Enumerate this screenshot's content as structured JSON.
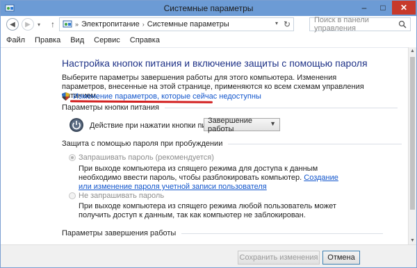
{
  "window": {
    "title": "Системные параметры"
  },
  "nav": {
    "breadcrumbs": [
      "Электропитание",
      "Системные параметры"
    ],
    "search_placeholder": "Поиск в панели управления"
  },
  "menu": [
    "Файл",
    "Правка",
    "Вид",
    "Сервис",
    "Справка"
  ],
  "main": {
    "title": "Настройка кнопок питания и включение защиты с помощью пароля",
    "intro": "Выберите параметры завершения работы для этого компьютера. Изменения параметров, внесенные на этой странице, применяются ко всем схемам управления питанием.",
    "change_link": "Изменение параметров, которые сейчас недоступны",
    "power_section": {
      "heading": "Параметры кнопки питания",
      "action_label": "Действие при нажатии кнопки питания:",
      "action_value": "Завершение работы"
    },
    "password_section": {
      "heading": "Защита с помощью пароля при пробуждении",
      "require": {
        "label": "Запрашивать пароль (рекомендуется)",
        "desc": "При выходе компьютера из спящего режима для доступа к данным необходимо ввести пароль, чтобы разблокировать компьютер.",
        "link": "Создание или изменение пароля учетной записи пользователя"
      },
      "no_require": {
        "label": "Не запрашивать пароль",
        "desc": "При выходе компьютера из спящего режима любой пользователь может получить доступ к данным, так как компьютер не заблокирован."
      }
    },
    "shutdown_section": {
      "heading": "Параметры завершения работы"
    }
  },
  "footer": {
    "save_label": "Сохранить изменения",
    "cancel_label": "Отмена"
  },
  "colors": {
    "title_bar": "#6c9bd5",
    "link": "#1155cc",
    "heading": "#1e3287",
    "annotation": "#d21e1e"
  }
}
